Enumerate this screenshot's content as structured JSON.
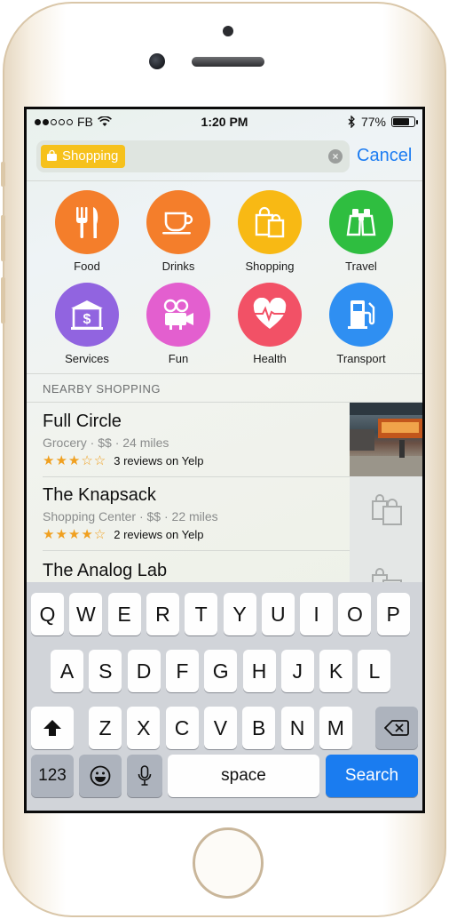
{
  "status_bar": {
    "carrier": "FB",
    "time": "1:20 PM",
    "battery": "77%",
    "battery_level": 0.77
  },
  "search": {
    "chip_label": "Shopping",
    "cancel_label": "Cancel"
  },
  "categories": [
    {
      "label": "Food",
      "color": "#f47e2b",
      "icon": "fork-knife-icon"
    },
    {
      "label": "Drinks",
      "color": "#f47e2b",
      "icon": "cup-icon"
    },
    {
      "label": "Shopping",
      "color": "#f8b914",
      "icon": "shopping-bags-icon"
    },
    {
      "label": "Travel",
      "color": "#2fbe40",
      "icon": "binoculars-icon"
    },
    {
      "label": "Services",
      "color": "#9164e0",
      "icon": "bank-icon"
    },
    {
      "label": "Fun",
      "color": "#e35fcf",
      "icon": "movie-camera-icon"
    },
    {
      "label": "Health",
      "color": "#f25166",
      "icon": "heart-icon"
    },
    {
      "label": "Transport",
      "color": "#2f8ff2",
      "icon": "fuel-pump-icon"
    }
  ],
  "nearby": {
    "header": "NEARBY SHOPPING",
    "results": [
      {
        "name": "Full Circle",
        "meta": "Grocery  ·  $$  ·  24 miles",
        "stars": "★★★☆☆",
        "reviews": "3 reviews on Yelp",
        "rating": 3
      },
      {
        "name": "The Knapsack",
        "meta": "Shopping Center  ·  $$  ·  22 miles",
        "stars": "★★★★☆",
        "reviews": "2 reviews on Yelp",
        "rating": 4
      },
      {
        "name": "The Analog Lab",
        "meta": "",
        "stars": "",
        "reviews": ""
      }
    ]
  },
  "keyboard": {
    "row1": [
      "Q",
      "W",
      "E",
      "R",
      "T",
      "Y",
      "U",
      "I",
      "O",
      "P"
    ],
    "row2": [
      "A",
      "S",
      "D",
      "F",
      "G",
      "H",
      "J",
      "K",
      "L"
    ],
    "row3": [
      "Z",
      "X",
      "C",
      "V",
      "B",
      "N",
      "M"
    ],
    "numbers_key": "123",
    "space_key": "space",
    "search_key": "Search"
  }
}
